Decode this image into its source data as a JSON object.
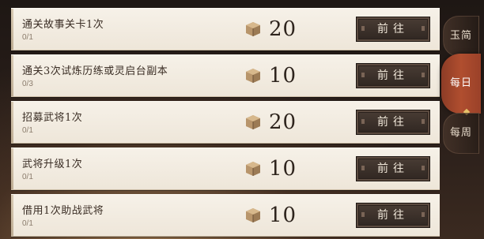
{
  "tasks": [
    {
      "title": "通关故事关卡1次",
      "progress": "0/1",
      "reward": "20",
      "button": "前往"
    },
    {
      "title": "通关3次试炼历练或灵启台副本",
      "progress": "0/3",
      "reward": "10",
      "button": "前往"
    },
    {
      "title": "招募武将1次",
      "progress": "0/1",
      "reward": "20",
      "button": "前往"
    },
    {
      "title": "武将升级1次",
      "progress": "0/1",
      "reward": "10",
      "button": "前往"
    },
    {
      "title": "借用1次助战武将",
      "progress": "0/1",
      "reward": "10",
      "button": "前往"
    }
  ],
  "tabs": [
    {
      "label": "玉简",
      "active": false
    },
    {
      "label": "每日",
      "active": true
    },
    {
      "label": "每周",
      "active": false
    }
  ],
  "reward_icon": "crate-icon",
  "colors": {
    "accent": "#a94a2c",
    "button_bg": "#3a2f29",
    "card_bg": "#f3ede2"
  }
}
